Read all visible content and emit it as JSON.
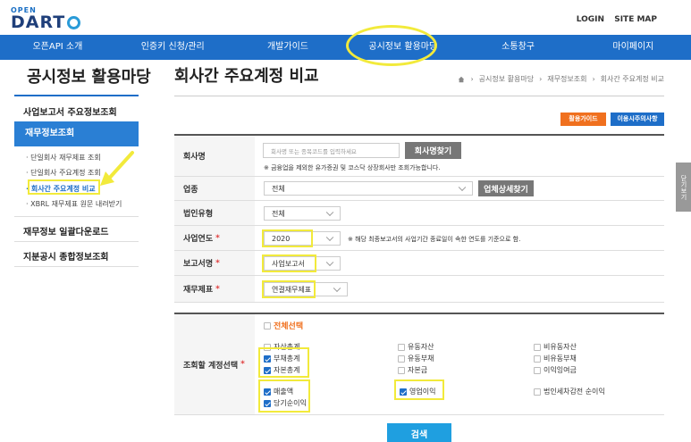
{
  "logo": {
    "top": "OPEN",
    "main": "DART"
  },
  "top_links": [
    "LOGIN",
    "SITE MAP"
  ],
  "nav": [
    "오픈API 소개",
    "인증키 신청/관리",
    "개발가이드",
    "공시정보 활용마당",
    "소통창구",
    "마이페이지"
  ],
  "sidebar": {
    "title": "공시정보 활용마당",
    "menu1": "사업보고서 주요정보조회",
    "active": "재무정보조회",
    "subs": [
      "단일회사 재무제표 조회",
      "단일회사 주요계정 조회",
      "회사간 주요계정 비교",
      "XBRL 재무제표 원문 내려받기"
    ],
    "menu2": "재무정보 일괄다운로드",
    "menu3": "지분공시 종합정보조회"
  },
  "page": {
    "title": "회사간 주요계정 비교",
    "breadcrumb": [
      "공시정보 활용마당",
      "재무정보조회",
      "회사간 주요계정 비교"
    ]
  },
  "buttons": {
    "guide": "활용가이드",
    "notice": "이용시주의사항",
    "search_company": "회사명찾기",
    "industry_detail": "업체상세찾기",
    "search": "검색"
  },
  "form": {
    "company": {
      "label": "회사명",
      "placeholder": "회사명 또는 종목코드를 입력하세요",
      "note": "※ 금융업을 제외한 유가증권 및 코스닥 상장회사만 조회가능합니다."
    },
    "industry": {
      "label": "업종",
      "value": "전체"
    },
    "corp_type": {
      "label": "법인유형",
      "value": "전체"
    },
    "year": {
      "label": "사업연도",
      "value": "2020",
      "note": "※ 해당 최종보고서의 사업기간 종료일이 속한 연도를 기준으로 함."
    },
    "report": {
      "label": "보고서명",
      "value": "사업보고서"
    },
    "statement": {
      "label": "재무제표",
      "value": "연결재무제표"
    },
    "accounts": {
      "label": "조회할 계정선택",
      "select_all": "전체선택",
      "items": [
        {
          "label": "자산총계",
          "checked": false
        },
        {
          "label": "유동자산",
          "checked": false
        },
        {
          "label": "비유동자산",
          "checked": false
        },
        {
          "label": "부채총계",
          "checked": true
        },
        {
          "label": "유동부채",
          "checked": false
        },
        {
          "label": "비유동부채",
          "checked": false
        },
        {
          "label": "자본총계",
          "checked": true
        },
        {
          "label": "자본금",
          "checked": false
        },
        {
          "label": "이익잉여금",
          "checked": false
        },
        {
          "label": "매출액",
          "checked": true
        },
        {
          "label": "영업이익",
          "checked": true
        },
        {
          "label": "법인세차감전 순이익",
          "checked": false
        },
        {
          "label": "당기순이익",
          "checked": true
        }
      ]
    }
  },
  "side_tab": "닫기보기",
  "colors": {
    "nav": "#1e6ec8",
    "highlight": "#f2ea3b",
    "orange": "#f0701e",
    "search": "#1f9fe0"
  }
}
